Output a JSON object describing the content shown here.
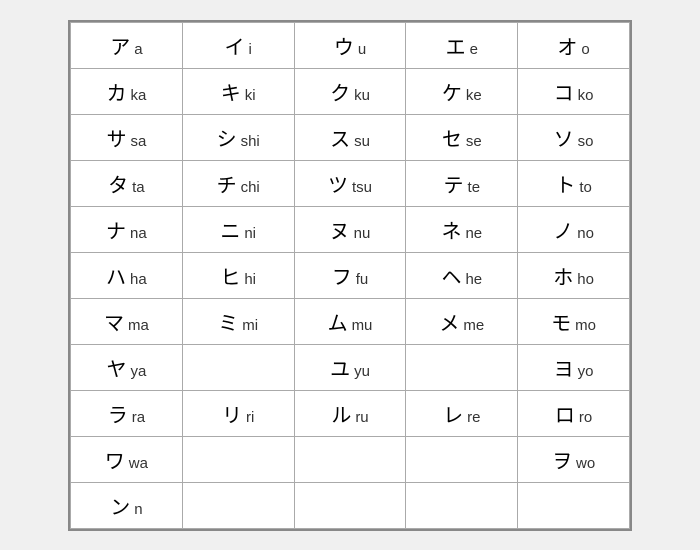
{
  "table": {
    "rows": [
      [
        {
          "kana": "ア",
          "roman": "a"
        },
        {
          "kana": "イ",
          "roman": "i"
        },
        {
          "kana": "ウ",
          "roman": "u"
        },
        {
          "kana": "エ",
          "roman": "e"
        },
        {
          "kana": "オ",
          "roman": "o"
        }
      ],
      [
        {
          "kana": "カ",
          "roman": "ka"
        },
        {
          "kana": "キ",
          "roman": "ki"
        },
        {
          "kana": "ク",
          "roman": "ku"
        },
        {
          "kana": "ケ",
          "roman": "ke"
        },
        {
          "kana": "コ",
          "roman": "ko"
        }
      ],
      [
        {
          "kana": "サ",
          "roman": "sa"
        },
        {
          "kana": "シ",
          "roman": "shi"
        },
        {
          "kana": "ス",
          "roman": "su"
        },
        {
          "kana": "セ",
          "roman": "se"
        },
        {
          "kana": "ソ",
          "roman": "so"
        }
      ],
      [
        {
          "kana": "タ",
          "roman": "ta"
        },
        {
          "kana": "チ",
          "roman": "chi"
        },
        {
          "kana": "ツ",
          "roman": "tsu"
        },
        {
          "kana": "テ",
          "roman": "te"
        },
        {
          "kana": "ト",
          "roman": "to"
        }
      ],
      [
        {
          "kana": "ナ",
          "roman": "na"
        },
        {
          "kana": "ニ",
          "roman": "ni"
        },
        {
          "kana": "ヌ",
          "roman": "nu"
        },
        {
          "kana": "ネ",
          "roman": "ne"
        },
        {
          "kana": "ノ",
          "roman": "no"
        }
      ],
      [
        {
          "kana": "ハ",
          "roman": "ha"
        },
        {
          "kana": "ヒ",
          "roman": "hi"
        },
        {
          "kana": "フ",
          "roman": "fu"
        },
        {
          "kana": "ヘ",
          "roman": "he"
        },
        {
          "kana": "ホ",
          "roman": "ho"
        }
      ],
      [
        {
          "kana": "マ",
          "roman": "ma"
        },
        {
          "kana": "ミ",
          "roman": "mi"
        },
        {
          "kana": "ム",
          "roman": "mu"
        },
        {
          "kana": "メ",
          "roman": "me"
        },
        {
          "kana": "モ",
          "roman": "mo"
        }
      ],
      [
        {
          "kana": "ヤ",
          "roman": "ya"
        },
        {
          "kana": "",
          "roman": ""
        },
        {
          "kana": "ユ",
          "roman": "yu"
        },
        {
          "kana": "",
          "roman": ""
        },
        {
          "kana": "ヨ",
          "roman": "yo"
        }
      ],
      [
        {
          "kana": "ラ",
          "roman": "ra"
        },
        {
          "kana": "リ",
          "roman": "ri"
        },
        {
          "kana": "ル",
          "roman": "ru"
        },
        {
          "kana": "レ",
          "roman": "re"
        },
        {
          "kana": "ロ",
          "roman": "ro"
        }
      ],
      [
        {
          "kana": "ワ",
          "roman": "wa"
        },
        {
          "kana": "",
          "roman": ""
        },
        {
          "kana": "",
          "roman": ""
        },
        {
          "kana": "",
          "roman": ""
        },
        {
          "kana": "ヲ",
          "roman": "wo"
        }
      ],
      [
        {
          "kana": "ン",
          "roman": "n"
        },
        {
          "kana": "",
          "roman": ""
        },
        {
          "kana": "",
          "roman": ""
        },
        {
          "kana": "",
          "roman": ""
        },
        {
          "kana": "",
          "roman": ""
        }
      ]
    ]
  }
}
